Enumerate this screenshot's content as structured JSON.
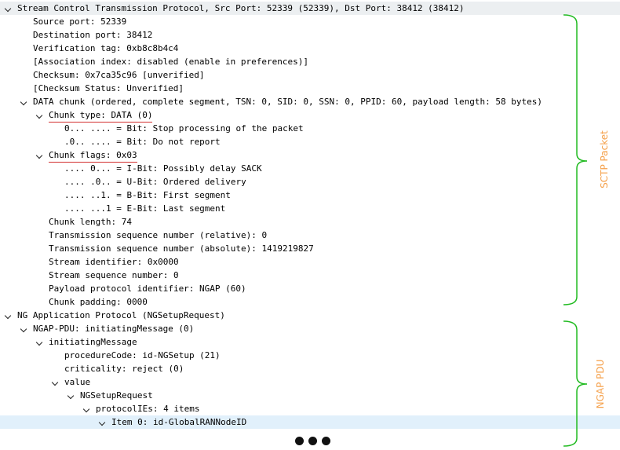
{
  "tree": [
    {
      "depth": 0,
      "expanded": true,
      "header": true,
      "text": "Stream Control Transmission Protocol, Src Port: 52339 (52339), Dst Port: 38412 (38412)"
    },
    {
      "depth": 1,
      "text": "Source port: 52339"
    },
    {
      "depth": 1,
      "text": "Destination port: 38412"
    },
    {
      "depth": 1,
      "text": "Verification tag: 0xb8c8b4c4"
    },
    {
      "depth": 1,
      "text": "[Association index: disabled (enable in preferences)]"
    },
    {
      "depth": 1,
      "text": "Checksum: 0x7ca35c96 [unverified]"
    },
    {
      "depth": 1,
      "text": "[Checksum Status: Unverified]"
    },
    {
      "depth": 1,
      "expanded": true,
      "text": "DATA chunk (ordered, complete segment, TSN: 0, SID: 0, SSN: 0, PPID: 60, payload length: 58 bytes)"
    },
    {
      "depth": 2,
      "expanded": true,
      "underline": true,
      "text": "Chunk type: DATA (0)"
    },
    {
      "depth": 3,
      "text": "0... .... = Bit: Stop processing of the packet"
    },
    {
      "depth": 3,
      "text": ".0.. .... = Bit: Do not report"
    },
    {
      "depth": 2,
      "expanded": true,
      "underline": true,
      "text": "Chunk flags: 0x03"
    },
    {
      "depth": 3,
      "text": ".... 0... = I-Bit: Possibly delay SACK"
    },
    {
      "depth": 3,
      "text": ".... .0.. = U-Bit: Ordered delivery"
    },
    {
      "depth": 3,
      "text": ".... ..1. = B-Bit: First segment"
    },
    {
      "depth": 3,
      "text": ".... ...1 = E-Bit: Last segment"
    },
    {
      "depth": 2,
      "text": "Chunk length: 74"
    },
    {
      "depth": 2,
      "text": "Transmission sequence number (relative): 0"
    },
    {
      "depth": 2,
      "text": "Transmission sequence number (absolute): 1419219827"
    },
    {
      "depth": 2,
      "text": "Stream identifier: 0x0000"
    },
    {
      "depth": 2,
      "text": "Stream sequence number: 0"
    },
    {
      "depth": 2,
      "text": "Payload protocol identifier: NGAP (60)"
    },
    {
      "depth": 2,
      "text": "Chunk padding: 0000"
    },
    {
      "depth": 0,
      "expanded": true,
      "text": "NG Application Protocol (NGSetupRequest)"
    },
    {
      "depth": 1,
      "expanded": true,
      "text": "NGAP-PDU: initiatingMessage (0)"
    },
    {
      "depth": 2,
      "expanded": true,
      "text": "initiatingMessage"
    },
    {
      "depth": 3,
      "text": "procedureCode: id-NGSetup (21)"
    },
    {
      "depth": 3,
      "text": "criticality: reject (0)"
    },
    {
      "depth": 3,
      "expanded": true,
      "text": "value"
    },
    {
      "depth": 4,
      "expanded": true,
      "text": "NGSetupRequest"
    },
    {
      "depth": 5,
      "expanded": true,
      "text": "protocolIEs: 4 items"
    },
    {
      "depth": 6,
      "expanded": true,
      "selected": true,
      "text": "Item 0: id-GlobalRANNodeID"
    }
  ],
  "annotations": {
    "sctp_label": "SCTP Packet",
    "ngap_label": "NGAP PDU",
    "color": "#f5a04a",
    "brace_color": "#22bb22"
  },
  "more_indicator": "ellipsis"
}
